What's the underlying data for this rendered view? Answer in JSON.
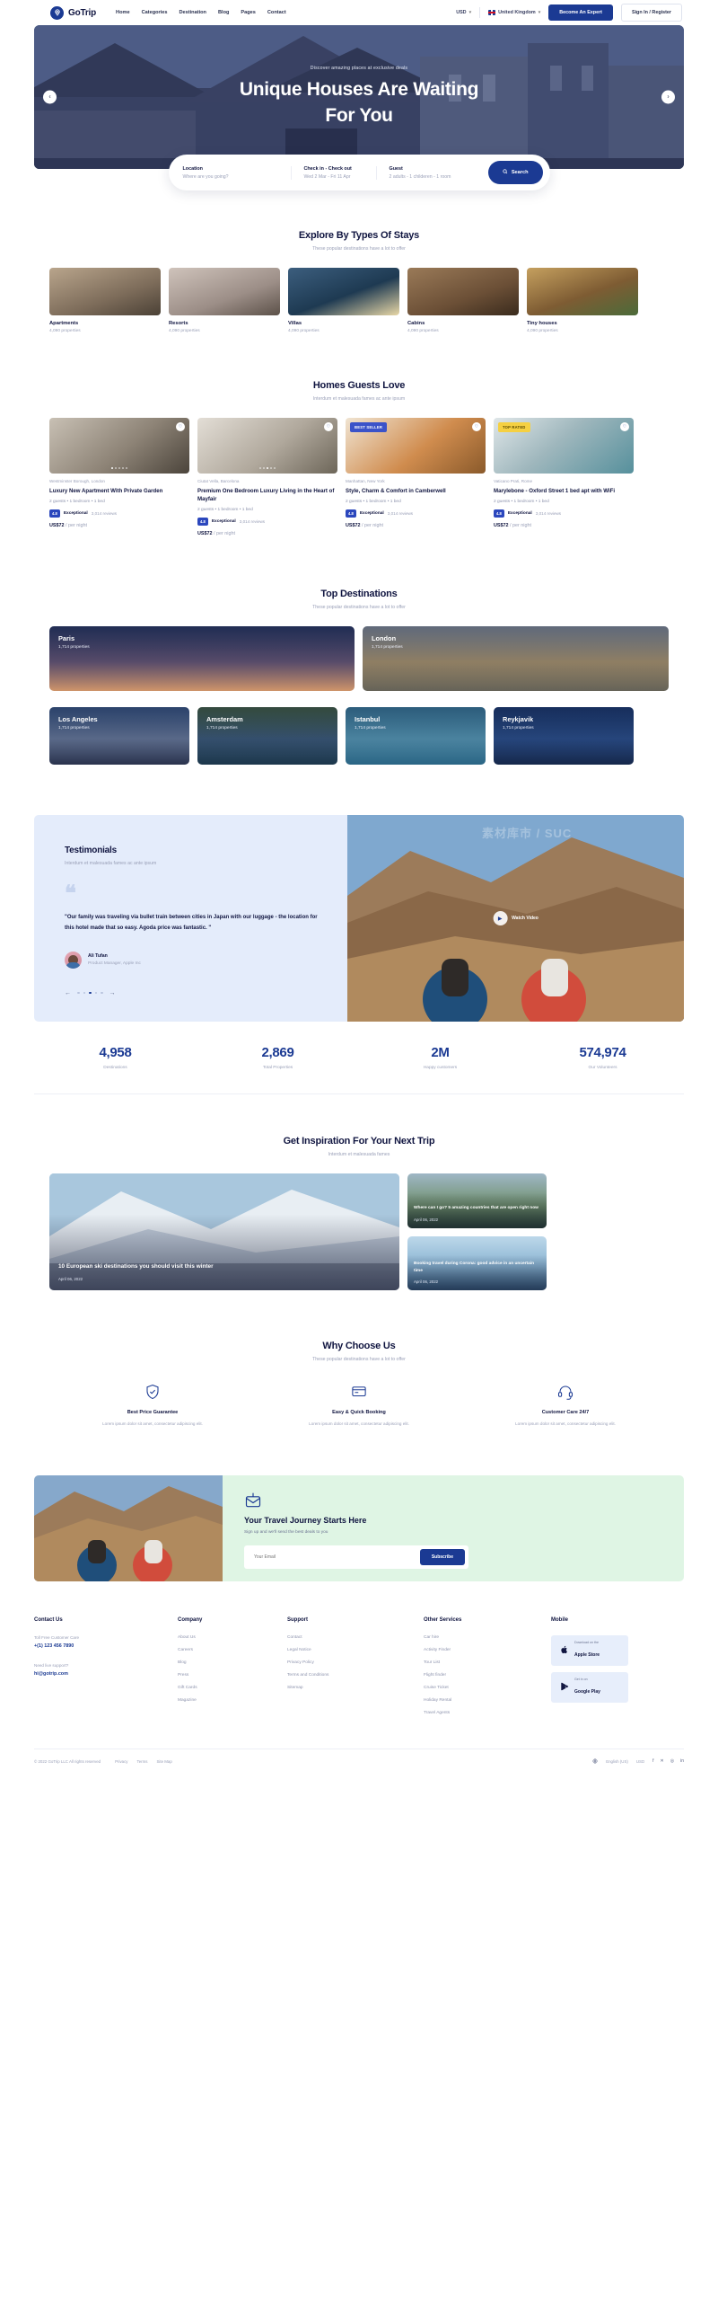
{
  "header": {
    "brand": "GoTrip",
    "nav": [
      "Home",
      "Categories",
      "Destination",
      "Blog",
      "Pages",
      "Contact"
    ],
    "currency": "USD",
    "country": "United Kingdom",
    "expert_btn": "Become An Expert",
    "signin_btn": "Sign In / Register"
  },
  "hero": {
    "kicker": "Discover amazing places at exclusive deals",
    "title_line1": "Unique Houses Are Waiting",
    "title_line2": "For You"
  },
  "search": {
    "location_label": "Location",
    "location_value": "Where are you going?",
    "dates_label": "Check in - Check out",
    "dates_value": "Wed 2 Mar  -  Fri 11 Apr",
    "guest_label": "Guest",
    "guest_value": "2 adults - 1 childeren - 1 room",
    "button": "Search"
  },
  "stays": {
    "title": "Explore By Types Of Stays",
    "subtitle": "These popular destinations have a lot to offer",
    "items": [
      {
        "name": "Apartments",
        "count": "4,090 properties"
      },
      {
        "name": "Resorts",
        "count": "4,090 properties"
      },
      {
        "name": "Villas",
        "count": "4,090 properties"
      },
      {
        "name": "Cabins",
        "count": "4,090 properties"
      },
      {
        "name": "Tiny houses",
        "count": "4,090 properties"
      }
    ]
  },
  "homes": {
    "title": "Homes Guests Love",
    "subtitle": "Interdum et malesuada fames ac ante ipsum",
    "items": [
      {
        "location": "Westminster Borough, London",
        "title": "Luxury New Apartment With Private Garden",
        "meta": "2 guests • 1 bedroom • 1 bed",
        "score": "4.8",
        "rating_word": "Exceptional",
        "reviews": "3,014 reviews",
        "price": "US$72",
        "price_unit": "/ per night",
        "badge": ""
      },
      {
        "location": "Ciutat Vella, Barcelona",
        "title": "Premium One Bedroom Luxury Living in the Heart of Mayfair",
        "meta": "2 guests • 1 bedroom • 1 bed",
        "score": "4.8",
        "rating_word": "Exceptional",
        "reviews": "3,014 reviews",
        "price": "US$72",
        "price_unit": "/ per night",
        "badge": ""
      },
      {
        "location": "Manhattan, New York",
        "title": "Style, Charm & Comfort in Camberwell",
        "meta": "2 guests • 1 bedroom • 1 bed",
        "score": "4.8",
        "rating_word": "Exceptional",
        "reviews": "3,014 reviews",
        "price": "US$72",
        "price_unit": "/ per night",
        "badge": "BEST SELLER"
      },
      {
        "location": "Vaticano Prati, Rome",
        "title": "Marylebone - Oxford Street 1 bed apt with WiFi",
        "meta": "2 guests • 1 bedroom • 1 bed",
        "score": "4.8",
        "rating_word": "Exceptional",
        "reviews": "3,014 reviews",
        "price": "US$72",
        "price_unit": "/ per night",
        "badge": "TOP RATED"
      }
    ]
  },
  "destinations": {
    "title": "Top Destinations",
    "subtitle": "These popular destinations have a lot to offer",
    "big": [
      {
        "name": "Paris",
        "count": "1,714 properties"
      },
      {
        "name": "London",
        "count": "1,714 properties"
      }
    ],
    "small": [
      {
        "name": "Los Angeles",
        "count": "1,714 properties"
      },
      {
        "name": "Amsterdam",
        "count": "1,714 properties"
      },
      {
        "name": "Istanbul",
        "count": "1,714 properties"
      },
      {
        "name": "Reykjavik",
        "count": "1,714 properties"
      }
    ]
  },
  "testimonials": {
    "title": "Testimonials",
    "subtitle": "Interdum et malesuada fames ac ante ipsum",
    "quote": "\"Our family was traveling via bullet train between cities in Japan with our luggage - the location for this hotel made that so easy. Agoda price was fantastic. \"",
    "person_name": "Ali Tufan",
    "person_role": "Product Manager, Apple Inc",
    "watch_label": "Watch Video",
    "watermark": "素材库市 / SUC"
  },
  "stats": [
    {
      "number": "4,958",
      "label": "Destinations"
    },
    {
      "number": "2,869",
      "label": "Total Properties"
    },
    {
      "number": "2M",
      "label": "Happy customers"
    },
    {
      "number": "574,974",
      "label": "Our Volunteers"
    }
  ],
  "inspiration": {
    "title": "Get Inspiration For Your Next Trip",
    "subtitle": "Interdum et malesuada fames",
    "main": {
      "title": "10 European ski destinations you should visit this winter",
      "date": "April 06, 2022"
    },
    "side": [
      {
        "title": "Where can I go? 5 amazing countries that are open right now",
        "date": "April 06, 2022"
      },
      {
        "title": "Booking travel during Corona: good advice in an uncertain time",
        "date": "April 06, 2022"
      }
    ]
  },
  "why": {
    "title": "Why Choose Us",
    "subtitle": "These popular destinations have a lot to offer",
    "items": [
      {
        "icon": "shield-icon",
        "title": "Best Price Guarantee",
        "desc": "Lorem ipsum dolor sit amet, consectetur adipiscing elit."
      },
      {
        "icon": "booking-icon",
        "title": "Easy & Quick Booking",
        "desc": "Lorem ipsum dolor sit amet, consectetur adipiscing elit."
      },
      {
        "icon": "support-icon",
        "title": "Customer Care 24/7",
        "desc": "Lorem ipsum dolor sit amet, consectetur adipiscing elit."
      }
    ]
  },
  "newsletter": {
    "title": "Your Travel Journey Starts Here",
    "subtitle": "Sign up and we'll send the best deals to you",
    "placeholder": "Your Email",
    "button": "Subscribe"
  },
  "footer": {
    "contact": {
      "heading": "Contact Us",
      "care_label": "Toll Free Customer Care",
      "phone": "+(1) 123 456 7890",
      "support_label": "Need live support?",
      "email": "hi@gotrip.com"
    },
    "company": {
      "heading": "Company",
      "items": [
        "About Us",
        "Careers",
        "Blog",
        "Press",
        "Gift Cards",
        "Magazine"
      ]
    },
    "support": {
      "heading": "Support",
      "items": [
        "Contact",
        "Legal Notice",
        "Privacy Policy",
        "Terms and Conditions",
        "Sitemap"
      ]
    },
    "other": {
      "heading": "Other Services",
      "items": [
        "Car hire",
        "Activity Finder",
        "Tour List",
        "Flight finder",
        "Cruise Ticket",
        "Holiday Rental",
        "Travel Agents"
      ]
    },
    "mobile": {
      "heading": "Mobile",
      "apple_sub": "Download on the",
      "apple_main": "Apple Store",
      "google_sub": "Get in on",
      "google_main": "Google Play"
    },
    "bottom": {
      "copyright": "© 2022 GoTrip LLC All rights reserved",
      "links": [
        "Privacy",
        "Terms",
        "Site Map"
      ],
      "language": "English (US)",
      "currency": "USD"
    }
  }
}
